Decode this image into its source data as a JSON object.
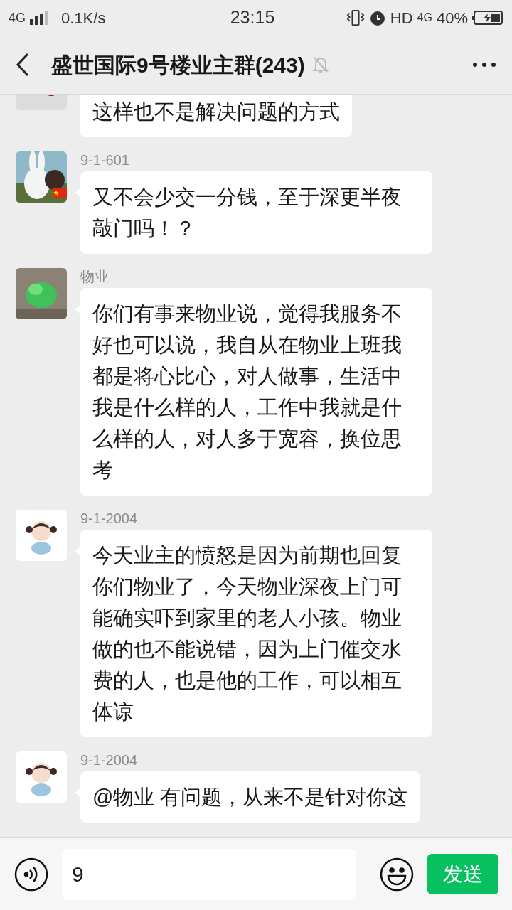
{
  "status_bar": {
    "network": "4G",
    "speed": "0.1K/s",
    "time": "23:15",
    "hd": "HD",
    "network_right": "4G",
    "battery": "40%"
  },
  "header": {
    "title": "盛世国际9号楼业主群(243)",
    "muted": true
  },
  "messages": [
    {
      "text": "这样也不是解决问题的方式",
      "flag_badge": false
    },
    {
      "sender": "9-1-601",
      "text": "又不会少交一分钱，至于深更半夜敲门吗！？",
      "flag_badge": true
    },
    {
      "sender": "物业",
      "text": "你们有事来物业说，觉得我服务不好也可以说，我自从在物业上班我都是将心比心，对人做事，生活中我是什么样的人，工作中我就是什么样的人，对人多于宽容，换位思考",
      "flag_badge": false
    },
    {
      "sender": "9-1-2004",
      "text": "今天业主的愤怒是因为前期也回复你们物业了，今天物业深夜上门可能确实吓到家里的老人小孩。物业做的也不能说错，因为上门催交水费的人，也是他的工作，可以相互体谅",
      "flag_badge": false
    },
    {
      "sender": "9-1-2004",
      "text": "@物业  有问题，从来不是针对你这",
      "flag_badge": false
    }
  ],
  "input": {
    "value": "9"
  },
  "send_button": "发送"
}
